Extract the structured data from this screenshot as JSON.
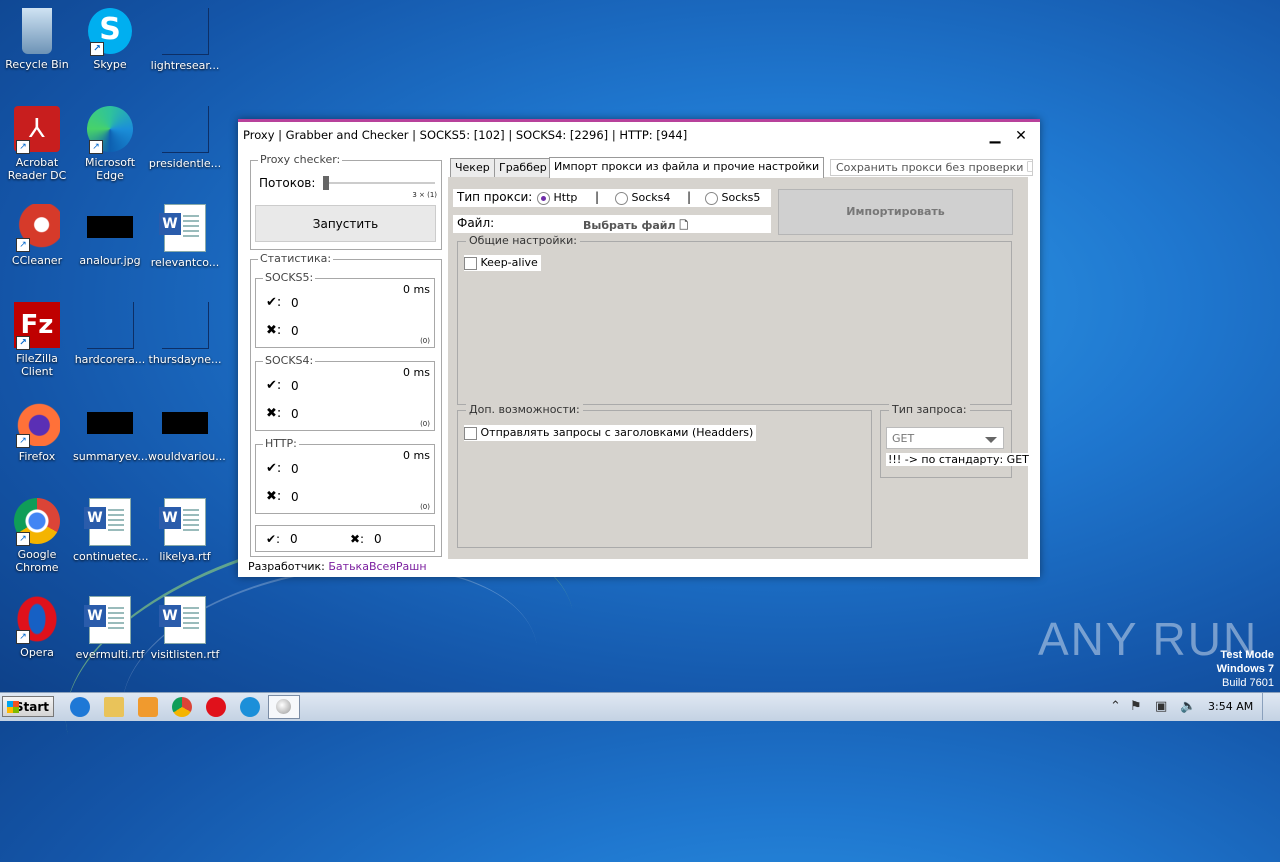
{
  "desktop": {
    "icons": [
      {
        "label": "Recycle Bin"
      },
      {
        "label": "Skype"
      },
      {
        "label": "lightresear..."
      },
      {
        "label": "Acrobat Reader DC"
      },
      {
        "label": "Microsoft Edge"
      },
      {
        "label": "presidentle..."
      },
      {
        "label": "CCleaner"
      },
      {
        "label": "analour.jpg"
      },
      {
        "label": "relevantco..."
      },
      {
        "label": "FileZilla Client"
      },
      {
        "label": "hardcorera..."
      },
      {
        "label": "thursdayne..."
      },
      {
        "label": "Firefox"
      },
      {
        "label": "summaryev..."
      },
      {
        "label": "wouldvariou..."
      },
      {
        "label": "Google Chrome"
      },
      {
        "label": "continuetec..."
      },
      {
        "label": "likelya.rtf"
      },
      {
        "label": "Opera"
      },
      {
        "label": "evermulti.rtf"
      },
      {
        "label": "visitlisten.rtf"
      }
    ],
    "watermark": "ANY RUN",
    "test_mode": [
      "Test Mode",
      "Windows 7",
      "Build 7601"
    ]
  },
  "window": {
    "title": "Proxy | Grabber and Checker | SOCKS5: [102] | SOCKS4: [2296] | HTTP: [944]",
    "minimize": "▁",
    "close": "✕",
    "checker": {
      "legend": "Proxy checker:",
      "threads_label": "Потоков:",
      "threads_value": "3 × (1)",
      "threads_fraction": 0.0,
      "start_button": "Запустить"
    },
    "stats": {
      "legend": "Статистика:",
      "groups": [
        {
          "name": "SOCKS5:",
          "ms": "0 ms",
          "ok": "0",
          "bad": "0",
          "small": "(0)"
        },
        {
          "name": "SOCKS4:",
          "ms": "0 ms",
          "ok": "0",
          "bad": "0",
          "small": "(0)"
        },
        {
          "name": "HTTP:",
          "ms": "0 ms",
          "ok": "0",
          "bad": "0",
          "small": "(0)"
        }
      ],
      "ok_mark": "✔:",
      "bad_mark": "✖:",
      "total_ok": "0",
      "total_bad": "0"
    },
    "developer_label": "Разработчик:",
    "developer_name": "БатькаВсеяРашн",
    "tabs": [
      "Чекер",
      "Граббер",
      "Импорт прокси из файла и прочие настройки"
    ],
    "save_without_check": "Сохранить прокси без проверки 🗋",
    "import": {
      "proxy_type_label": "Тип прокси:",
      "types": [
        "Http",
        "Socks4",
        "Socks5"
      ],
      "separator": "|",
      "file_label": "Файл:",
      "choose_file": "Выбрать файл 🗋",
      "import_button": "Импортировать"
    },
    "general": {
      "legend": "Общие настройки:",
      "keepalive": "Keep-alive"
    },
    "extra": {
      "legend": "Доп. возможности:",
      "headers": "Отправлять запросы с заголовками (Headders)"
    },
    "request": {
      "legend": "Тип запроса:",
      "value": "GET",
      "hint": "!!! -> по стандарту: GET"
    }
  },
  "taskbar": {
    "start": "Start",
    "time": "3:54 AM"
  }
}
